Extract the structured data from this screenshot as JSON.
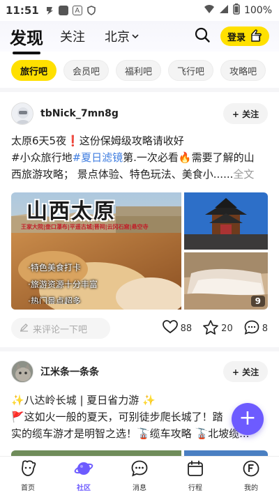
{
  "status": {
    "time": "11:51",
    "battery": "100%"
  },
  "header": {
    "tab_discover": "发现",
    "tab_follow": "关注",
    "city": "北京",
    "login": "登录"
  },
  "chips": [
    "旅行吧",
    "会员吧",
    "福利吧",
    "飞行吧",
    "攻略吧"
  ],
  "post1": {
    "username": "tbNick_7mn8g",
    "follow": "+ 关注",
    "line1": "太原6天5夜❗️这份保姆级攻略请收好",
    "line2_a": "#小众旅行地",
    "line2_tag": "#夏日滤镜",
    "line2_b": "第.一次必看🔥需要了解的山",
    "line3": "西旅游攻略； 景点体验、特色玩法、美食小......",
    "more": "全文",
    "image_title": "山西太原",
    "image_subtitle": "王家大院|壶口瀑布|平遥古城|晋祠|云冈石窟|悬空寺",
    "image_points": [
      "·特色美食打卡",
      "·旅游资源十分丰富",
      "·热门景点超多"
    ],
    "image_count": "9",
    "comment_placeholder": "来评论一下吧",
    "likes": "88",
    "favorites": "20",
    "comments": "8"
  },
  "post2": {
    "username": "江米条一条条",
    "follow": "+ 关注",
    "line1": "✨八达岭长城 | 夏日省力游 ✨",
    "line2": "🚩这如火一般的夏天，可别徒步爬长城了！踏",
    "line3": "实的缆车游才是明智之选！🚡缆车攻略 🚡北坡缆..."
  },
  "fab": "+",
  "nav": [
    {
      "label": "首页",
      "icon": "home-icon"
    },
    {
      "label": "社区",
      "icon": "planet-icon"
    },
    {
      "label": "消息",
      "icon": "message-icon"
    },
    {
      "label": "行程",
      "icon": "calendar-icon"
    },
    {
      "label": "我的",
      "icon": "profile-icon"
    }
  ],
  "colors": {
    "accent": "#ffe000",
    "brand": "#6d5bff",
    "tag": "#3f7de0"
  }
}
